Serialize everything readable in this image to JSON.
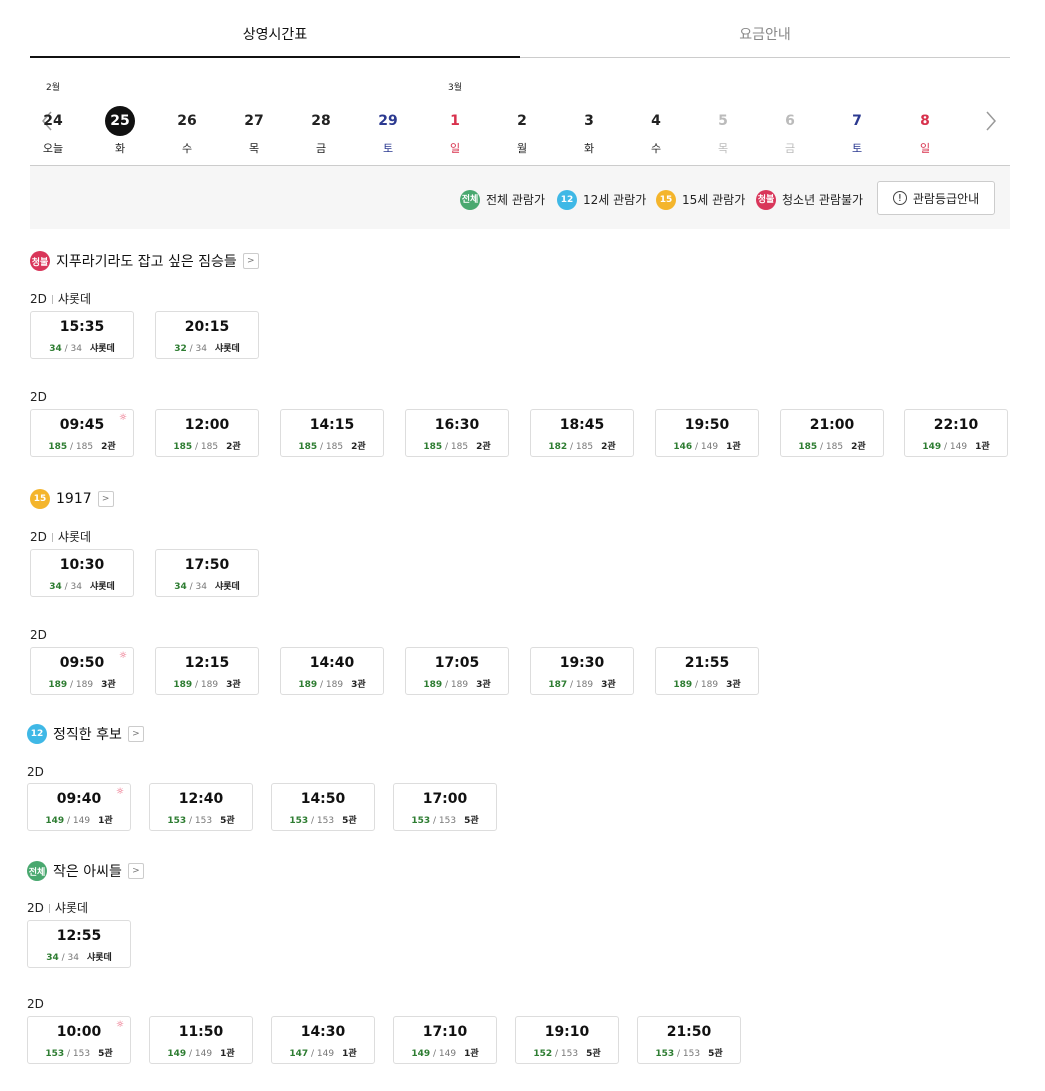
{
  "tabs": [
    {
      "label": "상영시간표"
    },
    {
      "label": "요금안내"
    }
  ],
  "dates": [
    {
      "month": "2월",
      "day": "24",
      "dow": "오늘",
      "color": "blk",
      "sel": false
    },
    {
      "month": "",
      "day": "25",
      "dow": "화",
      "color": "blk",
      "sel": true
    },
    {
      "month": "",
      "day": "26",
      "dow": "수",
      "color": "blk",
      "sel": false
    },
    {
      "month": "",
      "day": "27",
      "dow": "목",
      "color": "blk",
      "sel": false
    },
    {
      "month": "",
      "day": "28",
      "dow": "금",
      "color": "blk",
      "sel": false
    },
    {
      "month": "",
      "day": "29",
      "dow": "토",
      "color": "sat",
      "sel": false
    },
    {
      "month": "3월",
      "day": "1",
      "dow": "일",
      "color": "sun",
      "sel": false
    },
    {
      "month": "",
      "day": "2",
      "dow": "월",
      "color": "blk",
      "sel": false
    },
    {
      "month": "",
      "day": "3",
      "dow": "화",
      "color": "blk",
      "sel": false
    },
    {
      "month": "",
      "day": "4",
      "dow": "수",
      "color": "blk",
      "sel": false
    },
    {
      "month": "",
      "day": "5",
      "dow": "목",
      "color": "dis",
      "sel": false
    },
    {
      "month": "",
      "day": "6",
      "dow": "금",
      "color": "dis",
      "sel": false
    },
    {
      "month": "",
      "day": "7",
      "dow": "토",
      "color": "sat",
      "sel": false
    },
    {
      "month": "",
      "day": "8",
      "dow": "일",
      "color": "sun",
      "sel": false
    }
  ],
  "legend": {
    "all": {
      "badge": "전체",
      "label": "전체 관람가"
    },
    "r12": {
      "badge": "12",
      "label": "12세 관람가"
    },
    "r15": {
      "badge": "15",
      "label": "15세 관람가"
    },
    "r18": {
      "badge": "청불",
      "label": "청소년 관람불가"
    },
    "guide_label": "관람등급안내",
    "guide_icon": "!"
  },
  "colors": {
    "all": "#49a86f",
    "r12": "#3fb8e6",
    "r15": "#f4b52c",
    "r18": "#d9365a",
    "saturday": "#2b3990",
    "sunday": "#d8314c",
    "available": "#2e7d32"
  },
  "more_glyph": ">",
  "morning_icon": "☼",
  "movies": [
    {
      "badge": "청불",
      "rating": "r18",
      "title": "지푸라기라도 잡고 싶은 짐승들",
      "groups": [
        {
          "format": "2D",
          "sub": "샤롯데",
          "slots": [
            {
              "time": "15:35",
              "avail": "34",
              "total": "34",
              "hall": "샤롯데",
              "morning": false
            },
            {
              "time": "20:15",
              "avail": "32",
              "total": "34",
              "hall": "샤롯데",
              "morning": false
            }
          ]
        },
        {
          "format": "2D",
          "sub": "",
          "slots": [
            {
              "time": "09:45",
              "avail": "185",
              "total": "185",
              "hall": "2관",
              "morning": true
            },
            {
              "time": "12:00",
              "avail": "185",
              "total": "185",
              "hall": "2관",
              "morning": false
            },
            {
              "time": "14:15",
              "avail": "185",
              "total": "185",
              "hall": "2관",
              "morning": false
            },
            {
              "time": "16:30",
              "avail": "185",
              "total": "185",
              "hall": "2관",
              "morning": false
            },
            {
              "time": "18:45",
              "avail": "182",
              "total": "185",
              "hall": "2관",
              "morning": false
            },
            {
              "time": "19:50",
              "avail": "146",
              "total": "149",
              "hall": "1관",
              "morning": false
            },
            {
              "time": "21:00",
              "avail": "185",
              "total": "185",
              "hall": "2관",
              "morning": false
            },
            {
              "time": "22:10",
              "avail": "149",
              "total": "149",
              "hall": "1관",
              "morning": false
            }
          ]
        }
      ]
    },
    {
      "badge": "15",
      "rating": "r15",
      "title": "1917",
      "groups": [
        {
          "format": "2D",
          "sub": "샤롯데",
          "slots": [
            {
              "time": "10:30",
              "avail": "34",
              "total": "34",
              "hall": "샤롯데",
              "morning": false
            },
            {
              "time": "17:50",
              "avail": "34",
              "total": "34",
              "hall": "샤롯데",
              "morning": false
            }
          ]
        },
        {
          "format": "2D",
          "sub": "",
          "slots": [
            {
              "time": "09:50",
              "avail": "189",
              "total": "189",
              "hall": "3관",
              "morning": true
            },
            {
              "time": "12:15",
              "avail": "189",
              "total": "189",
              "hall": "3관",
              "morning": false
            },
            {
              "time": "14:40",
              "avail": "189",
              "total": "189",
              "hall": "3관",
              "morning": false
            },
            {
              "time": "17:05",
              "avail": "189",
              "total": "189",
              "hall": "3관",
              "morning": false
            },
            {
              "time": "19:30",
              "avail": "187",
              "total": "189",
              "hall": "3관",
              "morning": false
            },
            {
              "time": "21:55",
              "avail": "189",
              "total": "189",
              "hall": "3관",
              "morning": false
            }
          ]
        }
      ]
    },
    {
      "badge": "12",
      "rating": "r12",
      "title": "정직한 후보",
      "groups": [
        {
          "format": "2D",
          "sub": "",
          "slots": [
            {
              "time": "09:40",
              "avail": "149",
              "total": "149",
              "hall": "1관",
              "morning": true
            },
            {
              "time": "12:40",
              "avail": "153",
              "total": "153",
              "hall": "5관",
              "morning": false
            },
            {
              "time": "14:50",
              "avail": "153",
              "total": "153",
              "hall": "5관",
              "morning": false
            },
            {
              "time": "17:00",
              "avail": "153",
              "total": "153",
              "hall": "5관",
              "morning": false
            }
          ]
        }
      ]
    },
    {
      "badge": "전체",
      "rating": "all",
      "title": "작은 아씨들",
      "groups": [
        {
          "format": "2D",
          "sub": "샤롯데",
          "slots": [
            {
              "time": "12:55",
              "avail": "34",
              "total": "34",
              "hall": "샤롯데",
              "morning": false
            }
          ]
        },
        {
          "format": "2D",
          "sub": "",
          "slots": [
            {
              "time": "10:00",
              "avail": "153",
              "total": "153",
              "hall": "5관",
              "morning": true
            },
            {
              "time": "11:50",
              "avail": "149",
              "total": "149",
              "hall": "1관",
              "morning": false
            },
            {
              "time": "14:30",
              "avail": "147",
              "total": "149",
              "hall": "1관",
              "morning": false
            },
            {
              "time": "17:10",
              "avail": "149",
              "total": "149",
              "hall": "1관",
              "morning": false
            },
            {
              "time": "19:10",
              "avail": "152",
              "total": "153",
              "hall": "5관",
              "morning": false
            },
            {
              "time": "21:50",
              "avail": "153",
              "total": "153",
              "hall": "5관",
              "morning": false
            }
          ]
        }
      ]
    }
  ]
}
